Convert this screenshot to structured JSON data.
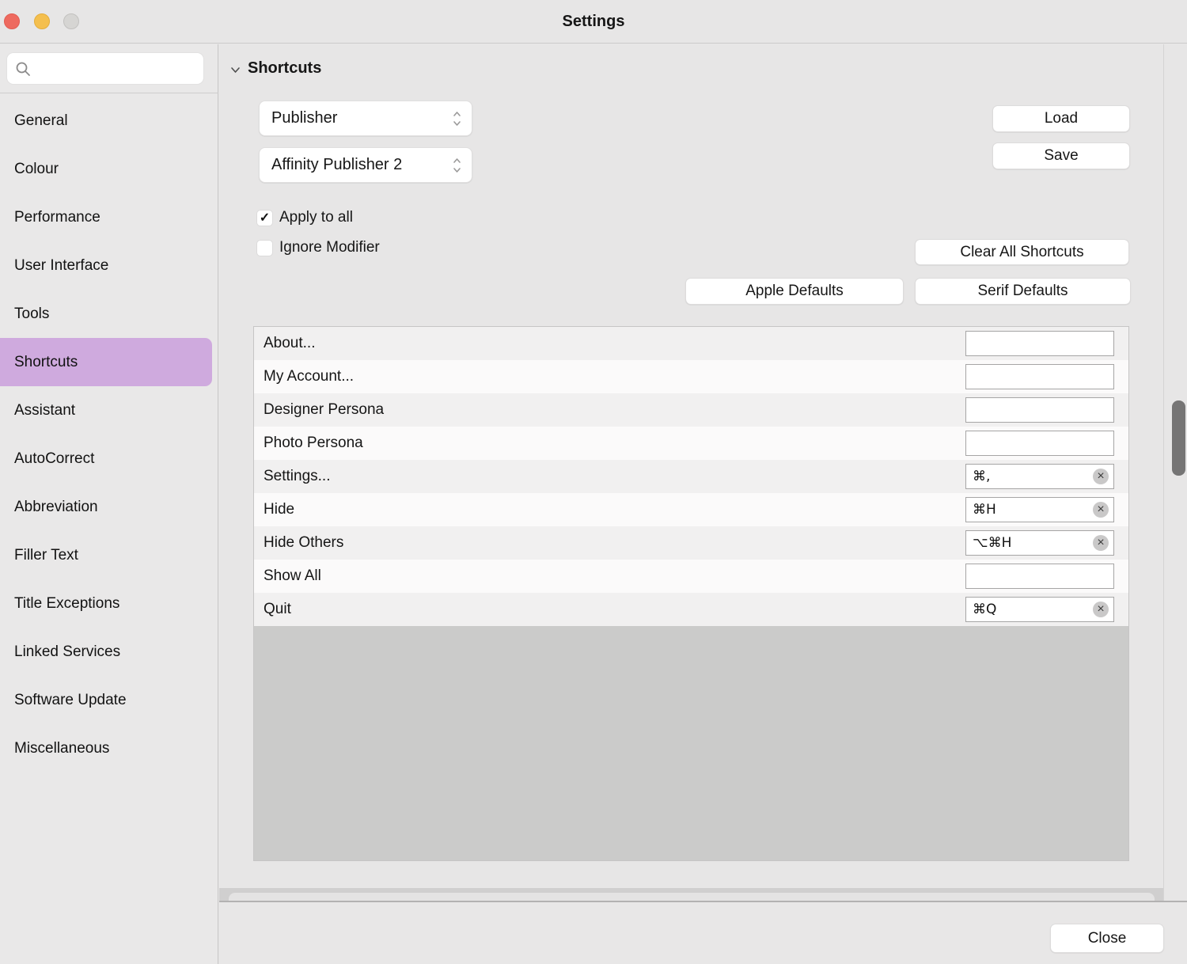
{
  "window": {
    "title": "Settings"
  },
  "colors": {
    "sidebar_selected": "#cfaade",
    "traffic_close": "#ee6a5f",
    "traffic_minimize": "#f4bf4e",
    "traffic_zoom_disabled": "#d6d5d3",
    "table_filler": "#cbcbca",
    "scroll_thumb": "#767575"
  },
  "sidebar": {
    "search_placeholder": "",
    "items": [
      {
        "label": "General",
        "selected": false
      },
      {
        "label": "Colour",
        "selected": false
      },
      {
        "label": "Performance",
        "selected": false
      },
      {
        "label": "User Interface",
        "selected": false
      },
      {
        "label": "Tools",
        "selected": false
      },
      {
        "label": "Shortcuts",
        "selected": true
      },
      {
        "label": "Assistant",
        "selected": false
      },
      {
        "label": "AutoCorrect",
        "selected": false
      },
      {
        "label": "Abbreviation",
        "selected": false
      },
      {
        "label": "Filler Text",
        "selected": false
      },
      {
        "label": "Title Exceptions",
        "selected": false
      },
      {
        "label": "Linked Services",
        "selected": false
      },
      {
        "label": "Software Update",
        "selected": false
      },
      {
        "label": "Miscellaneous",
        "selected": false
      }
    ]
  },
  "main": {
    "section_title": "Shortcuts",
    "dropdowns": [
      {
        "value": "Publisher"
      },
      {
        "value": "Affinity Publisher 2"
      }
    ],
    "buttons": {
      "load": "Load",
      "save": "Save",
      "clear_all": "Clear All Shortcuts",
      "apple_defaults": "Apple Defaults",
      "serif_defaults": "Serif Defaults"
    },
    "checkboxes": [
      {
        "label": "Apply to all",
        "checked": true
      },
      {
        "label": "Ignore Modifier",
        "checked": false
      }
    ],
    "shortcut_rows": [
      {
        "command": "About...",
        "shortcut": ""
      },
      {
        "command": "My Account...",
        "shortcut": ""
      },
      {
        "command": "Designer Persona",
        "shortcut": ""
      },
      {
        "command": "Photo Persona",
        "shortcut": ""
      },
      {
        "command": "Settings...",
        "shortcut": "⌘,"
      },
      {
        "command": "Hide",
        "shortcut": "⌘H"
      },
      {
        "command": "Hide Others",
        "shortcut": "⌥⌘H"
      },
      {
        "command": "Show All",
        "shortcut": ""
      },
      {
        "command": "Quit",
        "shortcut": "⌘Q"
      }
    ],
    "clear_icon_glyph": "×"
  },
  "footer": {
    "close_label": "Close"
  }
}
